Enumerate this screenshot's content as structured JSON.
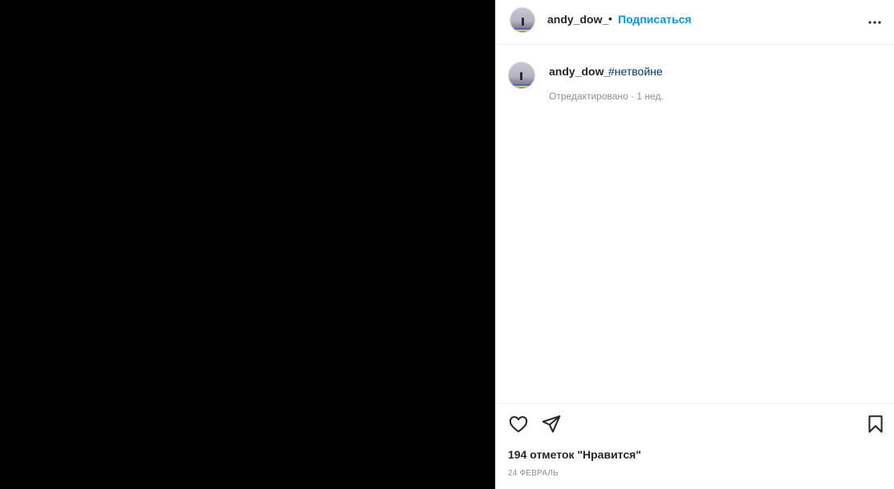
{
  "header": {
    "username": "andy_dow_",
    "separator": "•",
    "follow_label": "Подписаться"
  },
  "caption": {
    "username": "andy_dow_",
    "hashtag": "#нетвойне",
    "meta": "Отредактировано · 1 нед."
  },
  "footer": {
    "likes": "194 отметок \"Нравится\"",
    "date": "24 ФЕВРАЛЬ"
  },
  "icons": {
    "more": "more-horizontal-icon",
    "like": "heart-icon",
    "share": "paper-plane-icon",
    "save": "bookmark-icon"
  },
  "colors": {
    "accent": "#0095f6",
    "hashtag": "#00376b",
    "media_background": "#000000"
  }
}
